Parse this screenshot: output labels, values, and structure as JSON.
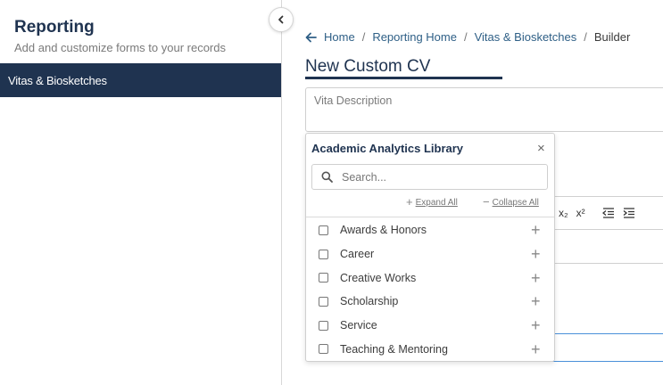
{
  "sidebar": {
    "title": "Reporting",
    "subtitle": "Add and customize forms to your records",
    "items": [
      {
        "label": "Vitas & Biosketches"
      }
    ]
  },
  "breadcrumb": {
    "items": [
      "Home",
      "Reporting Home",
      "Vitas & Biosketches"
    ],
    "separator": "/",
    "current": "Builder"
  },
  "page": {
    "title": "New Custom CV",
    "description_placeholder": "Vita Description"
  },
  "toolbar_glyphs": {
    "subscript": "x₂",
    "superscript": "x²"
  },
  "library": {
    "title": "Academic Analytics Library",
    "close_glyph": "×",
    "search_placeholder": "Search...",
    "expand_all": "Expand All",
    "collapse_all": "Collapse All",
    "items": [
      {
        "label": "Awards & Honors",
        "checked": false
      },
      {
        "label": "Career",
        "checked": false
      },
      {
        "label": "Creative Works",
        "checked": false
      },
      {
        "label": "Scholarship",
        "checked": false
      },
      {
        "label": "Service",
        "checked": false
      },
      {
        "label": "Teaching & Mentoring",
        "checked": false
      }
    ]
  },
  "colors": {
    "navy": "#1f3350",
    "link": "#2e5f86",
    "focus_border": "#4a90d9"
  }
}
